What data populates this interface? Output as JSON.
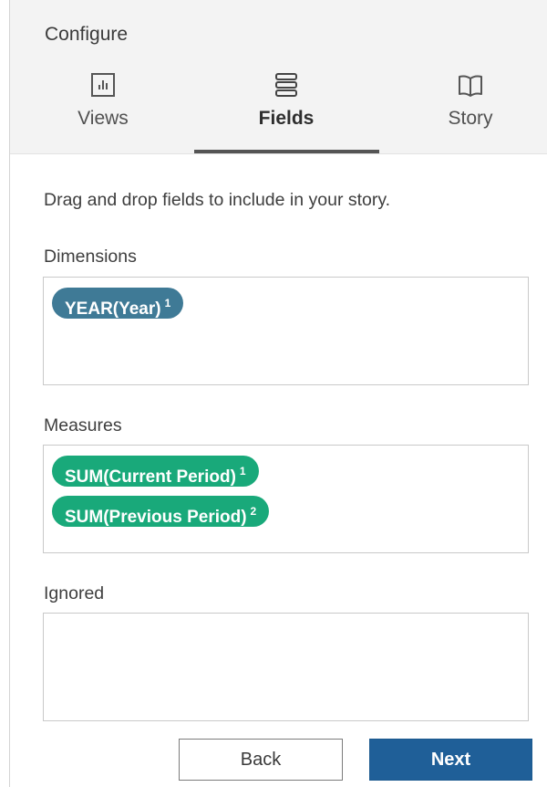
{
  "header": {
    "title": "Configure",
    "tabs": [
      {
        "label": "Views",
        "icon": "bar-chart-icon",
        "active": false
      },
      {
        "label": "Fields",
        "icon": "stack-icon",
        "active": true
      },
      {
        "label": "Story",
        "icon": "book-icon",
        "active": false
      }
    ]
  },
  "instructions": "Drag and drop fields to include in your story.",
  "sections": {
    "dimensions": {
      "label": "Dimensions",
      "pills": [
        {
          "text": "YEAR(Year)",
          "badge": "1"
        }
      ]
    },
    "measures": {
      "label": "Measures",
      "pills": [
        {
          "text": "SUM(Current Period)",
          "badge": "1"
        },
        {
          "text": "SUM(Previous Period)",
          "badge": "2"
        }
      ]
    },
    "ignored": {
      "label": "Ignored",
      "pills": []
    }
  },
  "buttons": {
    "back": "Back",
    "next": "Next"
  },
  "colors": {
    "dimension_pill": "#3f7a96",
    "measure_pill": "#19a97a",
    "primary_button": "#1f5f98",
    "header_bg": "#f3f3f3"
  }
}
